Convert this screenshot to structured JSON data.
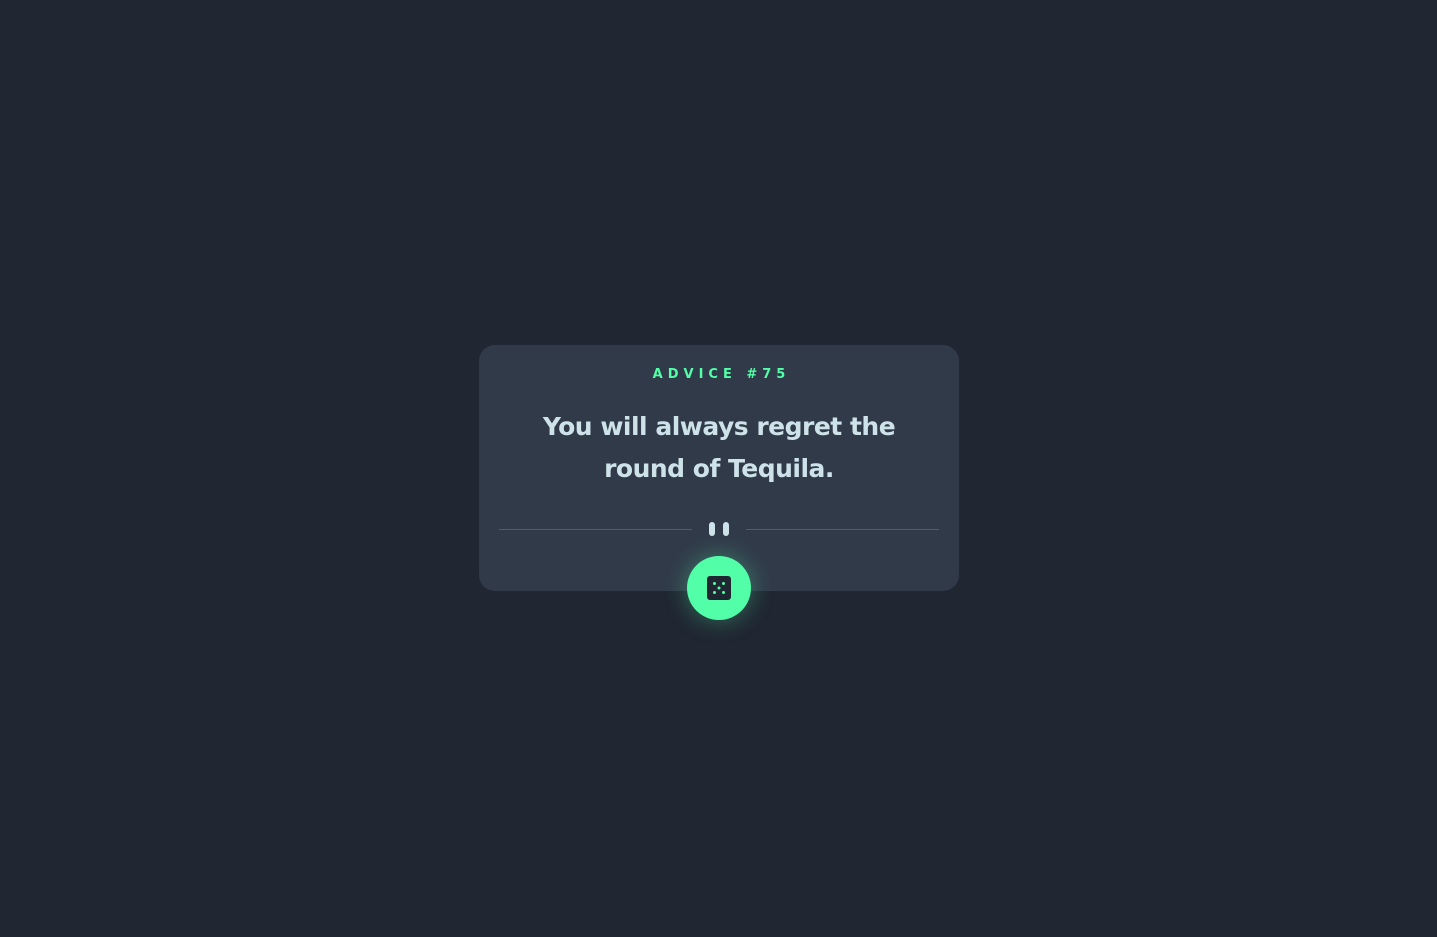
{
  "advice": {
    "label": "ADVICE #75",
    "text": "You will always regret the round of Tequila."
  },
  "icons": {
    "divider": "pause-icon",
    "button": "dice-icon"
  },
  "colors": {
    "background": "#202632",
    "card": "#313a49",
    "accent": "#52ffa8",
    "text": "#cee3e9",
    "divider": "#4f5d74"
  }
}
